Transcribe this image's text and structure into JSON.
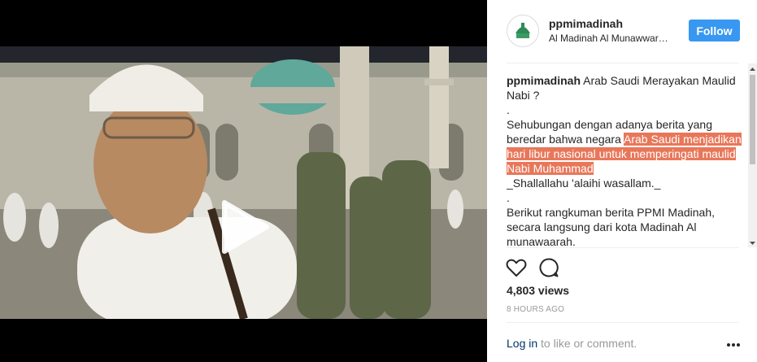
{
  "post": {
    "username": "ppmimadinah",
    "location": "Al Madinah Al Munawwarah, Saudi",
    "follow_label": "Follow",
    "caption_title": "Arab Saudi Merayakan Maulid Nabi ?",
    "caption_dot1": ".",
    "caption_p1_plain": "Sehubungan dengan adanya berita yang beredar bahwa negara ",
    "caption_p1_highlight": "Arab Saudi menjadikan hari libur nasional untuk memperingati maulid Nabi Muhammad",
    "caption_p1_tail": "_Shallallahu 'alaihi wasallam._",
    "caption_dot2": ".",
    "caption_p2": "Berikut rangkuman berita PPMI Madinah, secara langsung dari kota Madinah Al munawaarah.",
    "views": "4,803 views",
    "timestamp": "8 HOURS AGO",
    "login_link": "Log in",
    "login_rest": " to like or comment."
  },
  "icons": {
    "play": "play-icon",
    "like": "heart-icon",
    "comment": "comment-icon",
    "more": "more-options-icon"
  },
  "colors": {
    "follow_button": "#3897f0",
    "highlight": "#e8775a",
    "link": "#003569",
    "muted": "#999999"
  }
}
